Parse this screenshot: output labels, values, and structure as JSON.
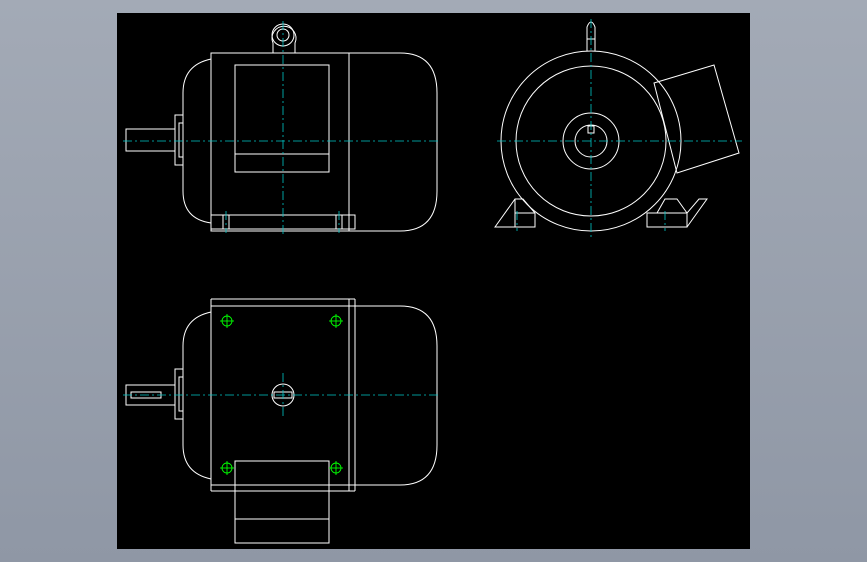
{
  "app": {
    "viewport_background": "#000000",
    "canvas_background": "#98a0ad",
    "line_color": "#ffffff",
    "centerline_color": "#00c8c8",
    "hole_mark_color": "#00ff00"
  },
  "views": [
    {
      "name": "front-view"
    },
    {
      "name": "side-view"
    },
    {
      "name": "top-view"
    }
  ]
}
